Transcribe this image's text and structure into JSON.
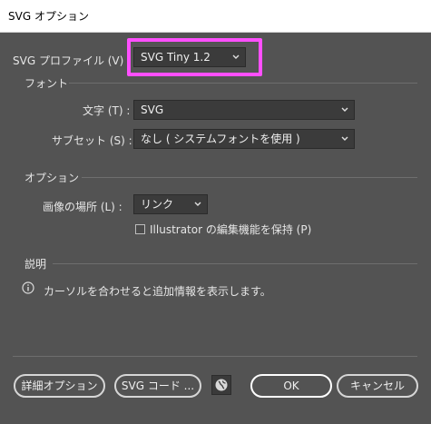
{
  "window": {
    "title": "SVG オプション"
  },
  "profile": {
    "label": "SVG プロファイル (V) :",
    "value": "SVG Tiny 1.2"
  },
  "font_section": {
    "title": "フォント",
    "type_label": "文字 (T) :",
    "type_value": "SVG",
    "subset_label": "サブセット (S) :",
    "subset_value": "なし ( システムフォントを使用 )"
  },
  "options_section": {
    "title": "オプション",
    "image_location_label": "画像の場所 (L) :",
    "image_location_value": "リンク",
    "preserve_label": "Illustrator の編集機能を保持 (P)",
    "preserve_checked": false
  },
  "description_section": {
    "title": "説明",
    "text": "カーソルを合わせると追加情報を表示します。"
  },
  "buttons": {
    "advanced": "詳細オプション",
    "svg_code": "SVG コード ...",
    "ok": "OK",
    "cancel": "キャンセル"
  },
  "colors": {
    "highlight": "#ff4fff",
    "panel": "#535353",
    "field": "#3b3b3b"
  },
  "icons": {
    "chevron": "chevron-down-icon",
    "info": "info-icon",
    "globe": "globe-icon"
  }
}
